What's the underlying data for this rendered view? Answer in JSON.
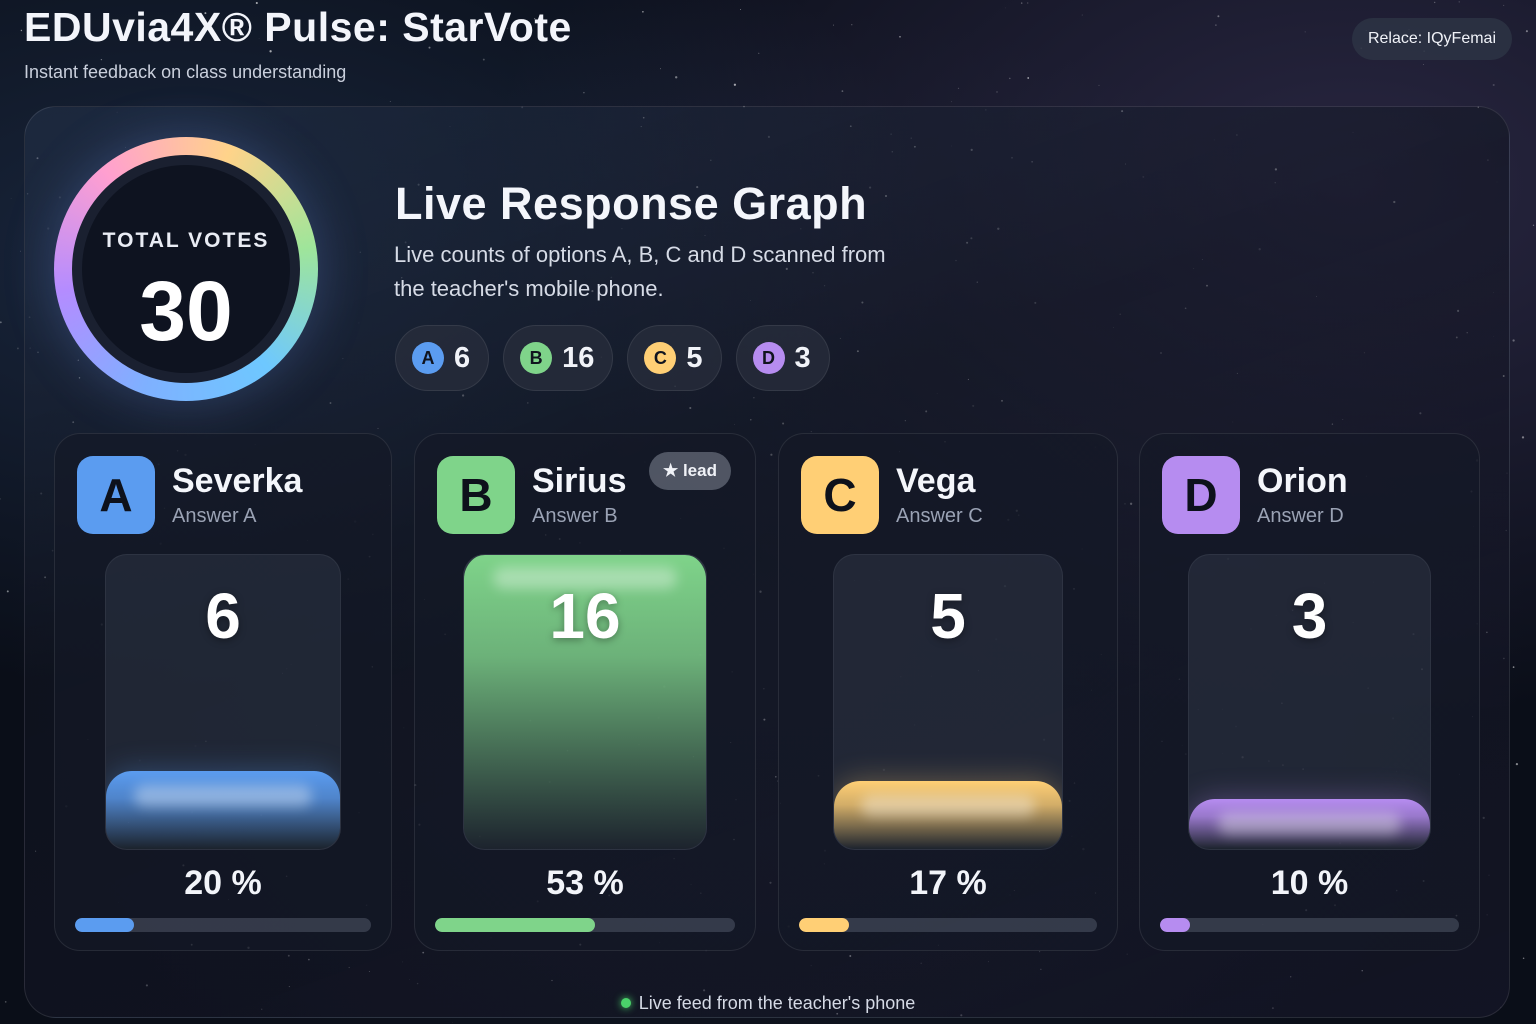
{
  "header": {
    "title": "EDUvia4X® Pulse: StarVote",
    "subtitle": "Instant feedback on class understanding",
    "user_label": "Relace: IQyFemai"
  },
  "total": {
    "label": "TOTAL VOTES",
    "value": "30"
  },
  "graph": {
    "title": "Live Response Graph",
    "description": "Live counts of options A, B, C and D scanned from the teacher's mobile phone."
  },
  "lead_label": "★ lead",
  "footer": {
    "text": "Live feed from the teacher's phone"
  },
  "colors": {
    "A": "#5b9cf0",
    "B": "#7fd48a",
    "C": "#ffcf75",
    "D": "#b68cf0"
  },
  "chart_data": {
    "type": "bar",
    "categories": [
      "A",
      "B",
      "C",
      "D"
    ],
    "names": [
      "Severka",
      "Sirius",
      "Vega",
      "Orion"
    ],
    "subtitles": [
      "Answer A",
      "Answer B",
      "Answer C",
      "Answer D"
    ],
    "values": [
      6,
      16,
      5,
      3
    ],
    "percent_labels": [
      "20 %",
      "53 %",
      "17 %",
      "10 %"
    ],
    "total": 30,
    "lead": "B"
  }
}
